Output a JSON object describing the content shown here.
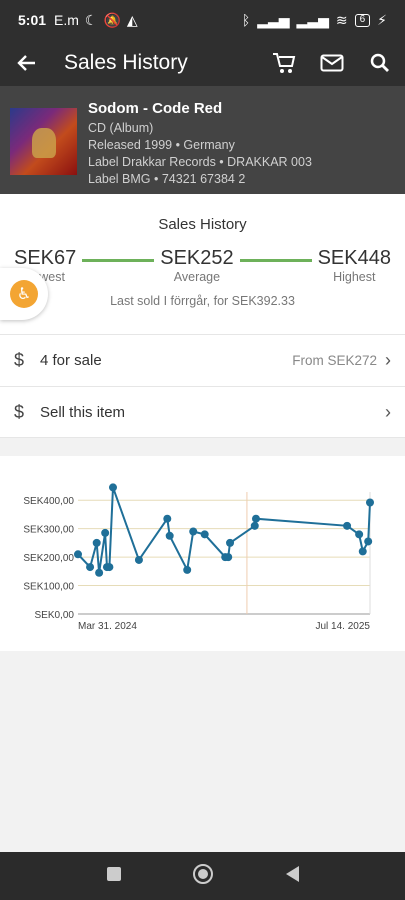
{
  "status": {
    "time": "5:01",
    "carrier": "E.m",
    "battery": "6"
  },
  "appbar": {
    "title": "Sales History"
  },
  "release": {
    "title": "Sodom - Code Red",
    "format": "CD (Album)",
    "released": "Released 1999  • Germany",
    "label1": "Label Drakkar Records • DRAKKAR 003",
    "label2": "Label BMG • 74321 67384 2"
  },
  "stats": {
    "heading": "Sales History",
    "lowest_value": "SEK67",
    "lowest_label": "Lowest",
    "average_value": "SEK252",
    "average_label": "Average",
    "highest_value": "SEK448",
    "highest_label": "Highest",
    "last_sold": "Last sold I förrgår, for SEK392.33"
  },
  "for_sale": {
    "label": "4 for sale",
    "from": "From SEK272"
  },
  "sell": {
    "label": "Sell this item"
  },
  "colors": {
    "accent_green": "#6db15a",
    "line_blue": "#1f6f98",
    "header_dark": "#2f2f2f"
  },
  "chart_data": {
    "type": "line",
    "x_tick_labels": [
      "Mar 31. 2024",
      "Jul 14. 2025"
    ],
    "y_tick_labels": [
      "SEK0,00",
      "SEK100,00",
      "SEK200,00",
      "SEK300,00",
      "SEK400,00"
    ],
    "ylim": [
      0,
      450
    ],
    "x_range": [
      "2024-03-31",
      "2025-07-28"
    ],
    "grid": true,
    "series": [
      {
        "points": [
          [
            "2024-03-31",
            210
          ],
          [
            "2024-04-20",
            165
          ],
          [
            "2024-05-01",
            250
          ],
          [
            "2024-05-05",
            145
          ],
          [
            "2024-05-15",
            285
          ],
          [
            "2024-05-18",
            165
          ],
          [
            "2024-05-22",
            165
          ],
          [
            "2024-05-28",
            445
          ],
          [
            "2024-07-10",
            190
          ],
          [
            "2024-08-26",
            335
          ],
          [
            "2024-08-30",
            275
          ],
          [
            "2024-09-28",
            155
          ],
          [
            "2024-10-08",
            290
          ],
          [
            "2024-10-27",
            280
          ],
          [
            "2024-11-30",
            200
          ],
          [
            "2024-12-05",
            200
          ],
          [
            "2024-12-08",
            250
          ],
          [
            "2025-01-18",
            310
          ],
          [
            "2025-01-20",
            335
          ],
          [
            "2025-06-20",
            310
          ],
          [
            "2025-07-10",
            280
          ],
          [
            "2025-07-16",
            220
          ],
          [
            "2025-07-25",
            255
          ],
          [
            "2025-07-28",
            392
          ]
        ]
      }
    ]
  }
}
